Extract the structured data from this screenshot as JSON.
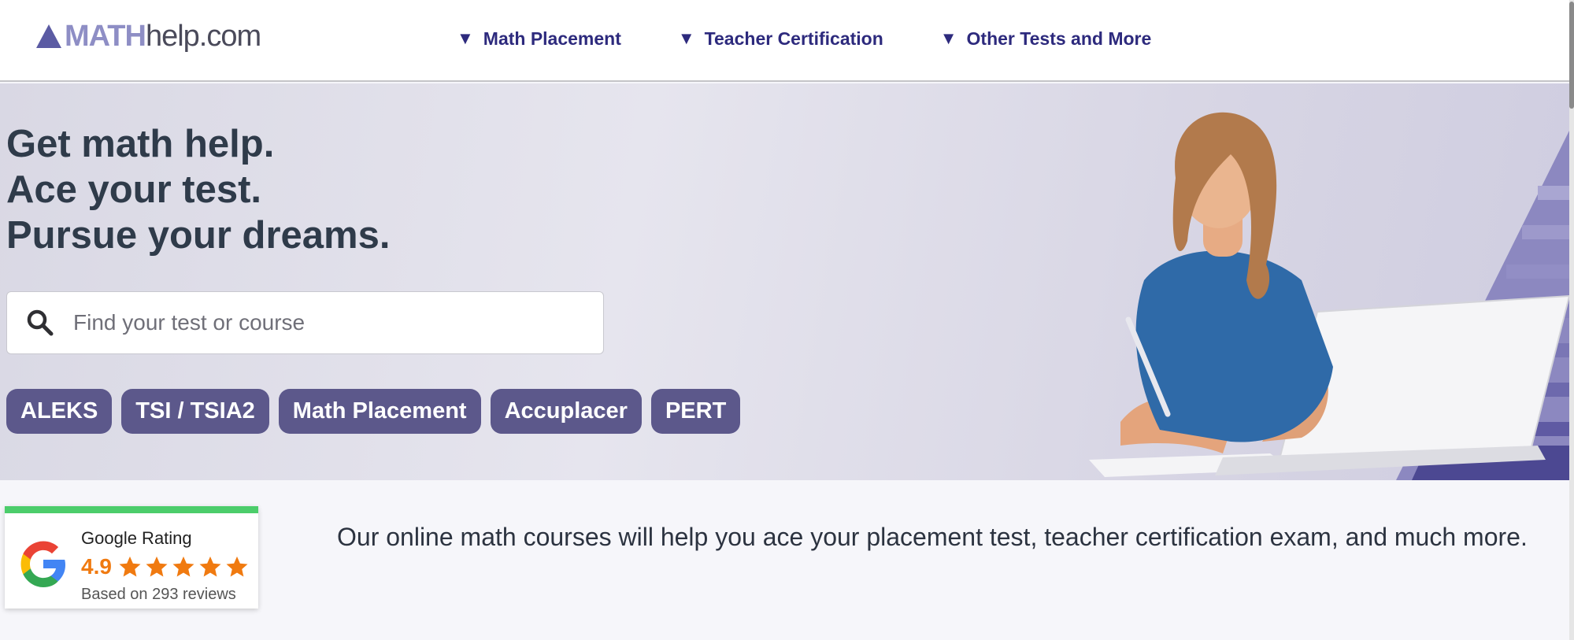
{
  "header": {
    "logo": {
      "main": "MATH",
      "sub": "help.com"
    },
    "nav": [
      {
        "label": "Math Placement"
      },
      {
        "label": "Teacher Certification"
      },
      {
        "label": "Other Tests and More"
      }
    ]
  },
  "hero": {
    "headline": [
      "Get math help.",
      "Ace your test.",
      "Pursue your dreams."
    ],
    "search": {
      "placeholder": "Find your test or course",
      "value": ""
    },
    "pills": [
      "ALEKS",
      "TSI / TSIA2",
      "Math Placement",
      "Accuplacer",
      "PERT"
    ]
  },
  "rating": {
    "title": "Google Rating",
    "score": "4.9",
    "stars": 5,
    "reviews_text": "Based on 293 reviews"
  },
  "intro_text": "Our online math courses will help you ace your placement test, teacher certification exam, and much more.",
  "colors": {
    "accent": "#2d2a7d",
    "pill": "#5c588b",
    "rating_orange": "#f07a10",
    "rating_bar": "#4ccd6b"
  },
  "icons": [
    "search-icon",
    "google-icon",
    "star-icon",
    "caret-down-icon"
  ]
}
